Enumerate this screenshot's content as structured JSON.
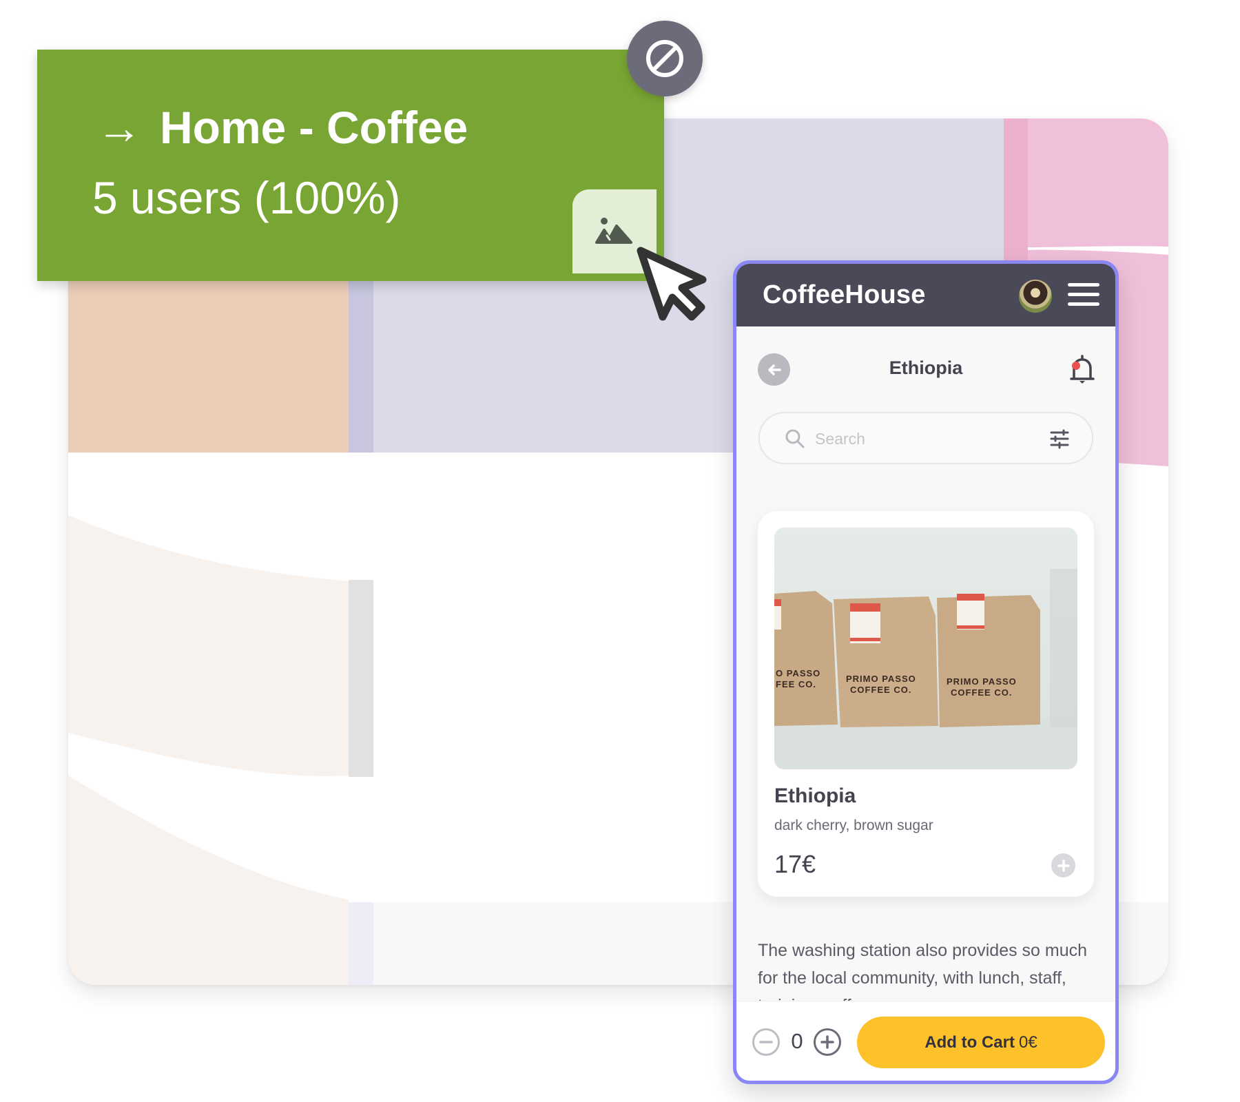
{
  "tooltip": {
    "arrow_icon": "arrow-right-icon",
    "arrow_glyph": "→",
    "title": "Home - Coffee",
    "users_text": "5 users (100%)",
    "color": "#79a534",
    "image_button_icon": "image-icon",
    "block_button_icon": "block-icon"
  },
  "flow_chart": {
    "node_colors": {
      "peach": "#ecceb8",
      "lavender": "#dbdae9",
      "lavender_node": "#c7c6de",
      "pink": "#f0c0da",
      "pink_node": "#ebb1cf",
      "gray_node": "#e1e1e1",
      "beige_flow": "#f7f2ee",
      "light_band": "#f8f8fa",
      "light_node": "#eeedf7"
    }
  },
  "phone": {
    "border_color": "#8a86f5",
    "header": {
      "app_name": "CoffeeHouse",
      "avatar_icon": "user-avatar",
      "menu_icon": "hamburger-menu-icon",
      "background": "#4a4958"
    },
    "nav": {
      "back_icon": "arrow-left-icon",
      "title": "Ethiopia",
      "bell_icon": "bell-icon",
      "notification_dot_color": "#e9504f"
    },
    "search": {
      "placeholder": "Search",
      "value": "",
      "search_icon": "search-icon",
      "filter_icon": "sliders-icon"
    },
    "product": {
      "image_alt": "Primo Passo Coffee Co. bags",
      "bag_label_line1": "PRIMO PASSO",
      "bag_label_line2": "COFFEE CO.",
      "name": "Ethiopia",
      "notes": "dark cherry, brown sugar",
      "price": "17€",
      "add_icon": "plus-icon"
    },
    "description": "The washing station also provides so much for the local community, with lunch, staff, training, coffee",
    "footer": {
      "minus_icon": "minus-circle-icon",
      "quantity": "0",
      "plus_icon": "plus-circle-icon",
      "cart_label": "Add to Cart",
      "cart_total": "0€",
      "cart_color": "#fdc12a"
    }
  }
}
